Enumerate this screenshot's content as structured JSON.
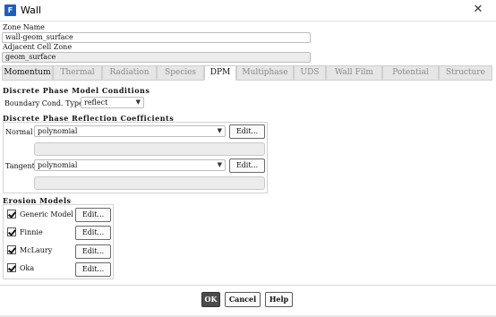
{
  "window": {
    "title": "Wall",
    "app_icon": "F"
  },
  "zone_name": {
    "label": "Zone Name",
    "value": "wall-geom_surface"
  },
  "adjacent_cell_zone": {
    "label": "Adjacent Cell Zone",
    "value": "geom_surface"
  },
  "tabs": [
    {
      "label": "Momentum"
    },
    {
      "label": "Thermal"
    },
    {
      "label": "Radiation"
    },
    {
      "label": "Species"
    },
    {
      "label": "DPM"
    },
    {
      "label": "Multiphase"
    },
    {
      "label": "UDS"
    },
    {
      "label": "Wall Film"
    },
    {
      "label": "Potential"
    },
    {
      "label": "Structure"
    }
  ],
  "active_tab": "DPM",
  "dpm_conditions": {
    "title": "Discrete Phase Model Conditions",
    "boundary_label": "Boundary Cond. Type",
    "boundary_value": "reflect"
  },
  "reflection": {
    "title": "Discrete Phase Reflection Coefficients",
    "normal_label": "Normal",
    "normal_value": "polynomial",
    "tangent_label": "Tangent",
    "tangent_value": "polynomial",
    "edit_label": "Edit..."
  },
  "erosion": {
    "title": "Erosion Models",
    "models": [
      {
        "label": "Generic Model",
        "checked": true
      },
      {
        "label": "Finnie",
        "checked": true
      },
      {
        "label": "McLaury",
        "checked": true
      },
      {
        "label": "Oka",
        "checked": true
      }
    ],
    "edit_label": "Edit..."
  },
  "footer": {
    "ok": "OK",
    "cancel": "Cancel",
    "help": "Help"
  },
  "colors": {
    "app_icon": "#1f5fb8",
    "ok_button": "#4b4b4b"
  }
}
